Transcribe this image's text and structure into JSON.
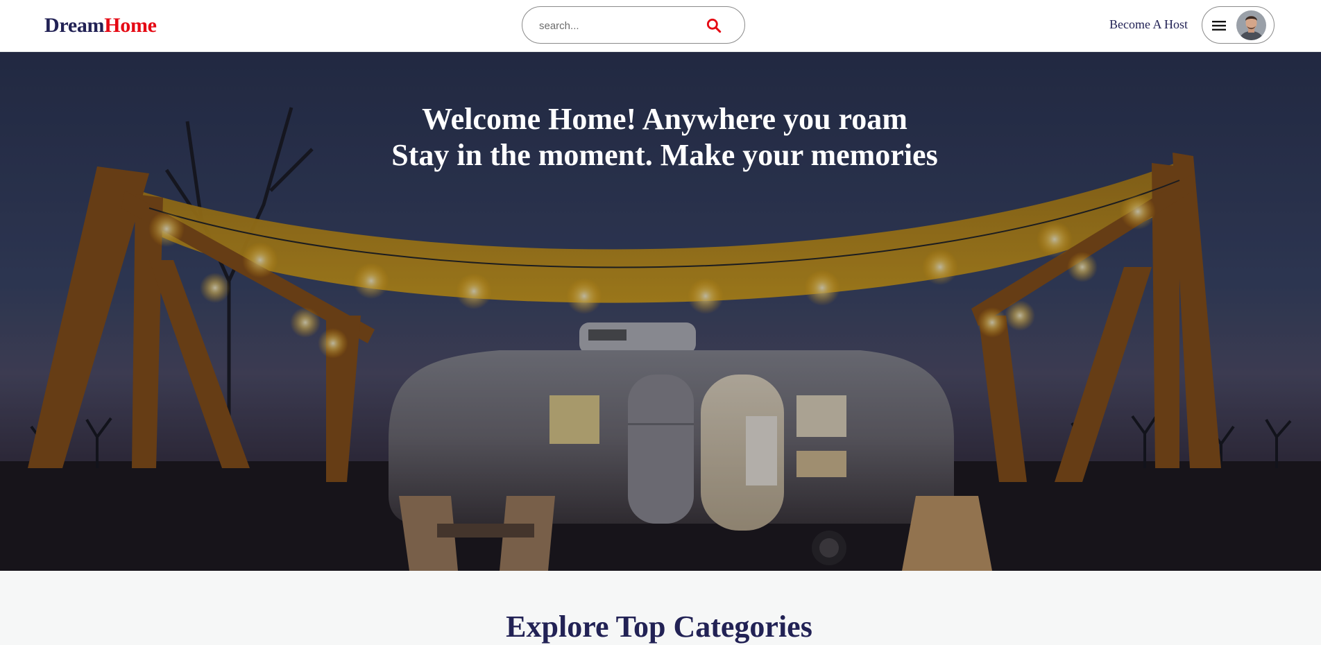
{
  "brand": {
    "part1": "Dream",
    "part2": "Home",
    "part1_color": "#222255",
    "part2_color": "#e50914"
  },
  "search": {
    "placeholder": "search...",
    "value": "",
    "icon": "search-icon",
    "icon_color": "#e50914"
  },
  "nav": {
    "host_link": "Become A Host",
    "menu_icon": "hamburger-menu-icon",
    "avatar": "user-avatar"
  },
  "hero": {
    "line1": "Welcome Home! Anywhere you roam",
    "line2": "Stay in the moment. Make your memories"
  },
  "categories": {
    "title": "Explore Top Categories"
  }
}
